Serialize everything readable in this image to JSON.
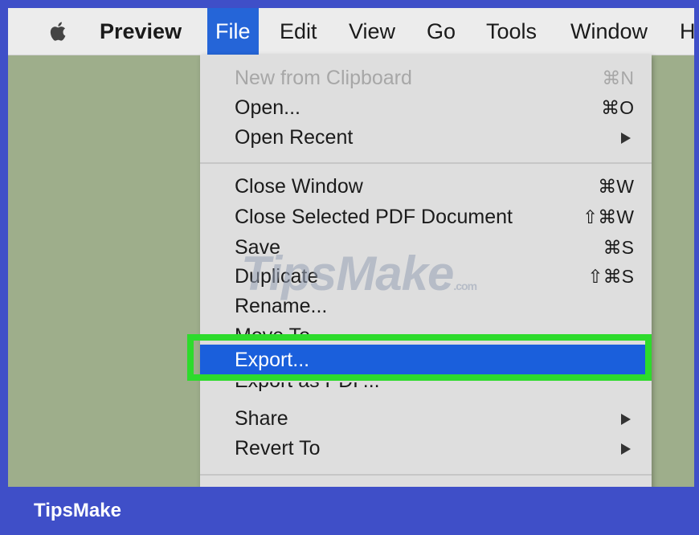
{
  "menubar": {
    "apple_icon": "apple-icon",
    "items": [
      {
        "label": "Preview"
      },
      {
        "label": "File"
      },
      {
        "label": "Edit"
      },
      {
        "label": "View"
      },
      {
        "label": "Go"
      },
      {
        "label": "Tools"
      },
      {
        "label": "Window"
      },
      {
        "label": "He"
      }
    ]
  },
  "file_menu": {
    "items": [
      {
        "label": "New from Clipboard",
        "shortcut": "⌘N",
        "disabled": true
      },
      {
        "label": "Open...",
        "shortcut": "⌘O"
      },
      {
        "label": "Open Recent",
        "submenu_icon": "chevron-right-icon"
      },
      {
        "label": "Close Window",
        "shortcut": "⌘W"
      },
      {
        "label": "Close Selected PDF Document",
        "shortcut": "⇧⌘W"
      },
      {
        "label": "Save",
        "shortcut": "⌘S"
      },
      {
        "label": "Duplicate",
        "shortcut": "⇧⌘S"
      },
      {
        "label": "Rename..."
      },
      {
        "label": "Move To..."
      },
      {
        "label": "Export...",
        "highlighted": true
      },
      {
        "label": "Export as PDF..."
      },
      {
        "label": "Share",
        "submenu_icon": "chevron-right-icon"
      },
      {
        "label": "Revert To",
        "submenu_icon": "chevron-right-icon"
      }
    ]
  },
  "watermark": {
    "text": "TipsMake",
    "suffix": ".com"
  },
  "footer": {
    "brand": "TipsMake"
  },
  "colors": {
    "frame": "#3f4fc8",
    "desktop": "#9eae8b",
    "menu_active": "#2565d8",
    "highlight": "#1a5fdc",
    "green_box": "#2ddb2c"
  }
}
